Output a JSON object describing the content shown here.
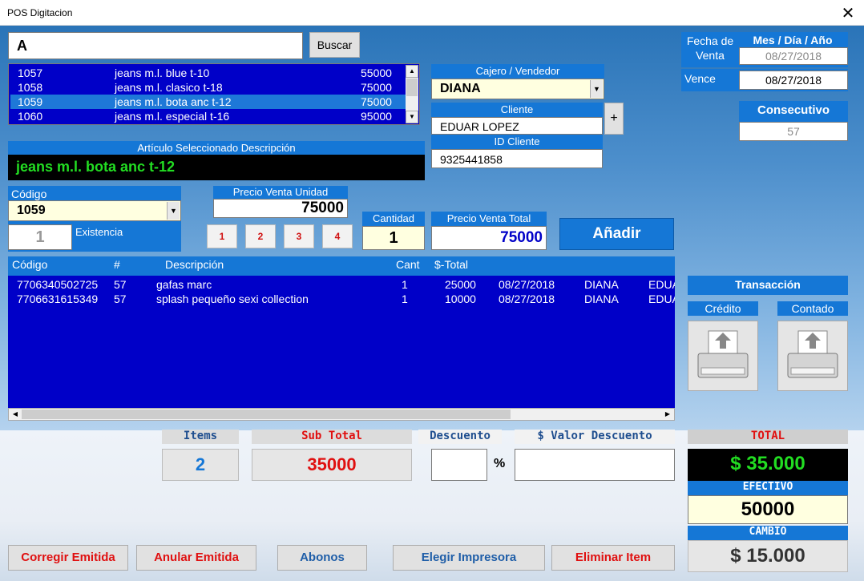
{
  "window": {
    "title": "POS Digitacion",
    "close": "✕"
  },
  "search": {
    "value": "A",
    "button": "Buscar"
  },
  "products": [
    {
      "code": "1057",
      "name": "jeans m.l. blue t-10",
      "price": "55000",
      "selected": false
    },
    {
      "code": "1058",
      "name": "jeans m.l. clasico t-18",
      "price": "75000",
      "selected": false
    },
    {
      "code": "1059",
      "name": "jeans m.l. bota anc t-12",
      "price": "75000",
      "selected": true
    },
    {
      "code": "1060",
      "name": "jeans m.l. especial t-16",
      "price": "95000",
      "selected": false
    }
  ],
  "cajero": {
    "label": "Cajero / Vendedor",
    "value": "DIANA"
  },
  "cliente": {
    "label": "Cliente",
    "value": "EDUAR LOPEZ",
    "add": "+"
  },
  "id_cliente": {
    "label": "ID Cliente",
    "value": "9325441858"
  },
  "fecha": {
    "label": "Fecha de Venta",
    "format": "Mes / Día / Año",
    "value": "08/27/2018"
  },
  "vence": {
    "label": "Vence",
    "value": "08/27/2018"
  },
  "consecutivo": {
    "label": "Consecutivo",
    "value": "57"
  },
  "articulo": {
    "label": "Artículo Seleccionado Descripción",
    "value": "jeans m.l. bota anc t-12"
  },
  "codigo": {
    "label": "Código",
    "value": "1059"
  },
  "existencia": {
    "label": "Existencia",
    "value": "1"
  },
  "precio_unidad": {
    "label": "Precio Venta Unidad",
    "value": "75000"
  },
  "quick_qty": [
    "1",
    "2",
    "3",
    "4"
  ],
  "cantidad": {
    "label": "Cantidad",
    "value": "1"
  },
  "precio_total": {
    "label": "Precio Venta  Total",
    "value": "75000"
  },
  "anadir": "Añadir",
  "grid": {
    "headers": [
      "Código",
      "#",
      "Descripción",
      "Cant",
      "$-Total"
    ],
    "rows": [
      {
        "codigo": "7706340502725",
        "num": "57",
        "desc": "gafas marc",
        "cant": "1",
        "total": "25000",
        "fecha": "08/27/2018",
        "vendedor": "DIANA",
        "cliente": "EDUA"
      },
      {
        "codigo": "7706631615349",
        "num": "57",
        "desc": "splash pequeño sexi collection",
        "cant": "1",
        "total": "10000",
        "fecha": "08/27/2018",
        "vendedor": "DIANA",
        "cliente": "EDUA"
      }
    ]
  },
  "transaccion": {
    "label": "Transacción",
    "credito": "Crédito",
    "contado": "Contado"
  },
  "summary": {
    "items_label": "Items",
    "items": "2",
    "subtotal_label": "Sub Total",
    "subtotal": "35000",
    "descuento_label": "Descuento",
    "descuento": "",
    "pct": "%",
    "valor_descuento_label": "$ Valor Descuento",
    "valor_descuento": ""
  },
  "total": {
    "label": "TOTAL",
    "value": "$ 35.000"
  },
  "efectivo": {
    "label": "EFECTIVO",
    "value": "50000"
  },
  "cambio": {
    "label": "CAMBIO",
    "value": "$ 15.000"
  },
  "buttons": {
    "corregir": "Corregir Emitida",
    "anular": "Anular Emitida",
    "abonos": "Abonos",
    "impresora": "Elegir Impresora",
    "eliminar": "Eliminar Item"
  },
  "colors": {
    "accent": "#1577d6",
    "list_bg": "#0000c8",
    "green": "#22dd22",
    "red": "#e01010"
  }
}
